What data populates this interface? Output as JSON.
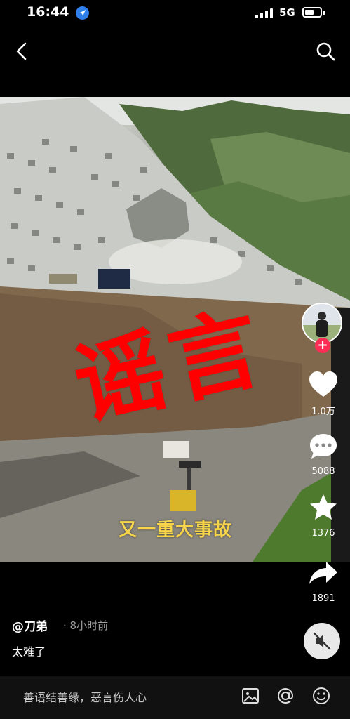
{
  "status_bar": {
    "time": "16:44",
    "network": "5G"
  },
  "video": {
    "stamp_text": "谣言",
    "caption": "又一重大事故"
  },
  "actions": {
    "likes": "1.0万",
    "comments": "5088",
    "favorites": "1376",
    "shares": "1891"
  },
  "post": {
    "author": "@刀弟",
    "time_ago": "· 8小时前",
    "description": "太难了"
  },
  "comment_bar": {
    "placeholder": "善语结善缘，恶言伤人心"
  },
  "colors": {
    "stamp_red": "#ff0000",
    "caption_yellow": "#f7d54a",
    "follow_red": "#fe2c55"
  },
  "icons": [
    "location-icon",
    "signal-icon",
    "battery-icon",
    "back-icon",
    "search-icon",
    "heart-icon",
    "comment-icon",
    "star-icon",
    "share-icon",
    "mute-icon",
    "image-icon",
    "at-icon",
    "emoji-icon"
  ]
}
